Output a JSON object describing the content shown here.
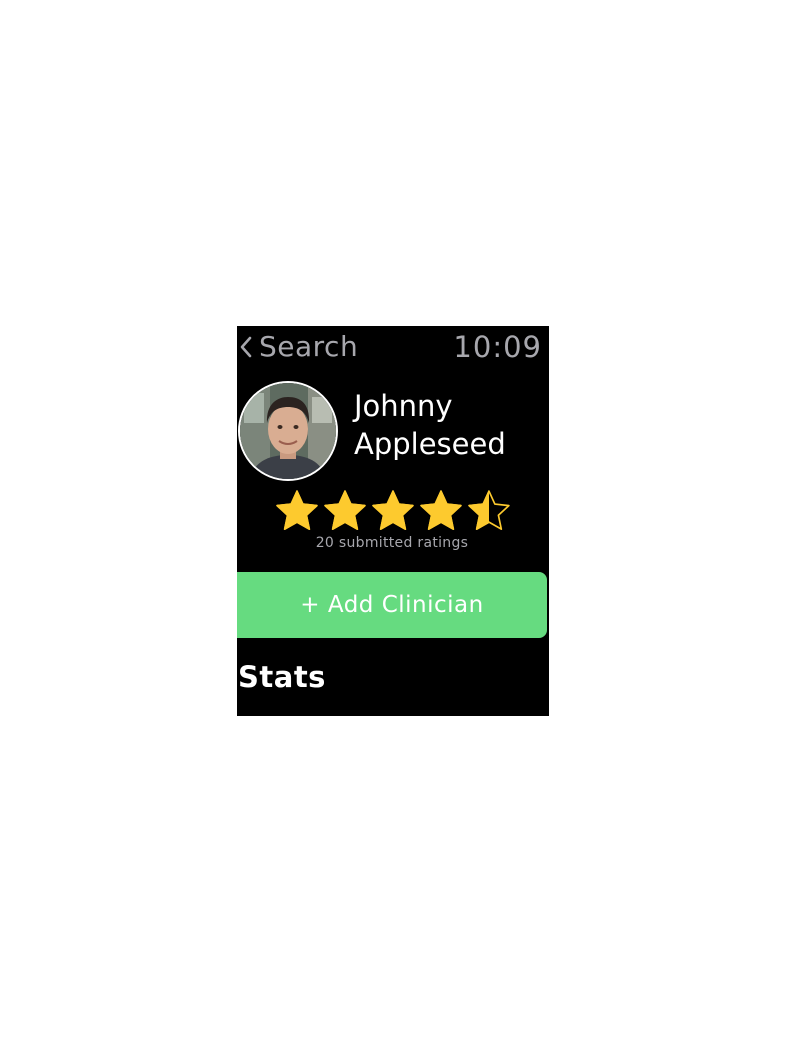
{
  "status_bar": {
    "back_label": "Search",
    "back_icon": "chevron-left-icon",
    "time": "10:09"
  },
  "profile": {
    "first_name": "Johnny",
    "last_name": "Appleseed",
    "avatar": "person-avatar"
  },
  "rating": {
    "value": 4.5,
    "max": 5,
    "count_text": "20 submitted ratings"
  },
  "actions": {
    "add_label": "+ Add Clinician"
  },
  "section": {
    "title": "Stats"
  },
  "colors": {
    "background": "#000000",
    "secondary_text": "#a7a7ad",
    "star": "#fdca2e",
    "button": "#66db80"
  }
}
